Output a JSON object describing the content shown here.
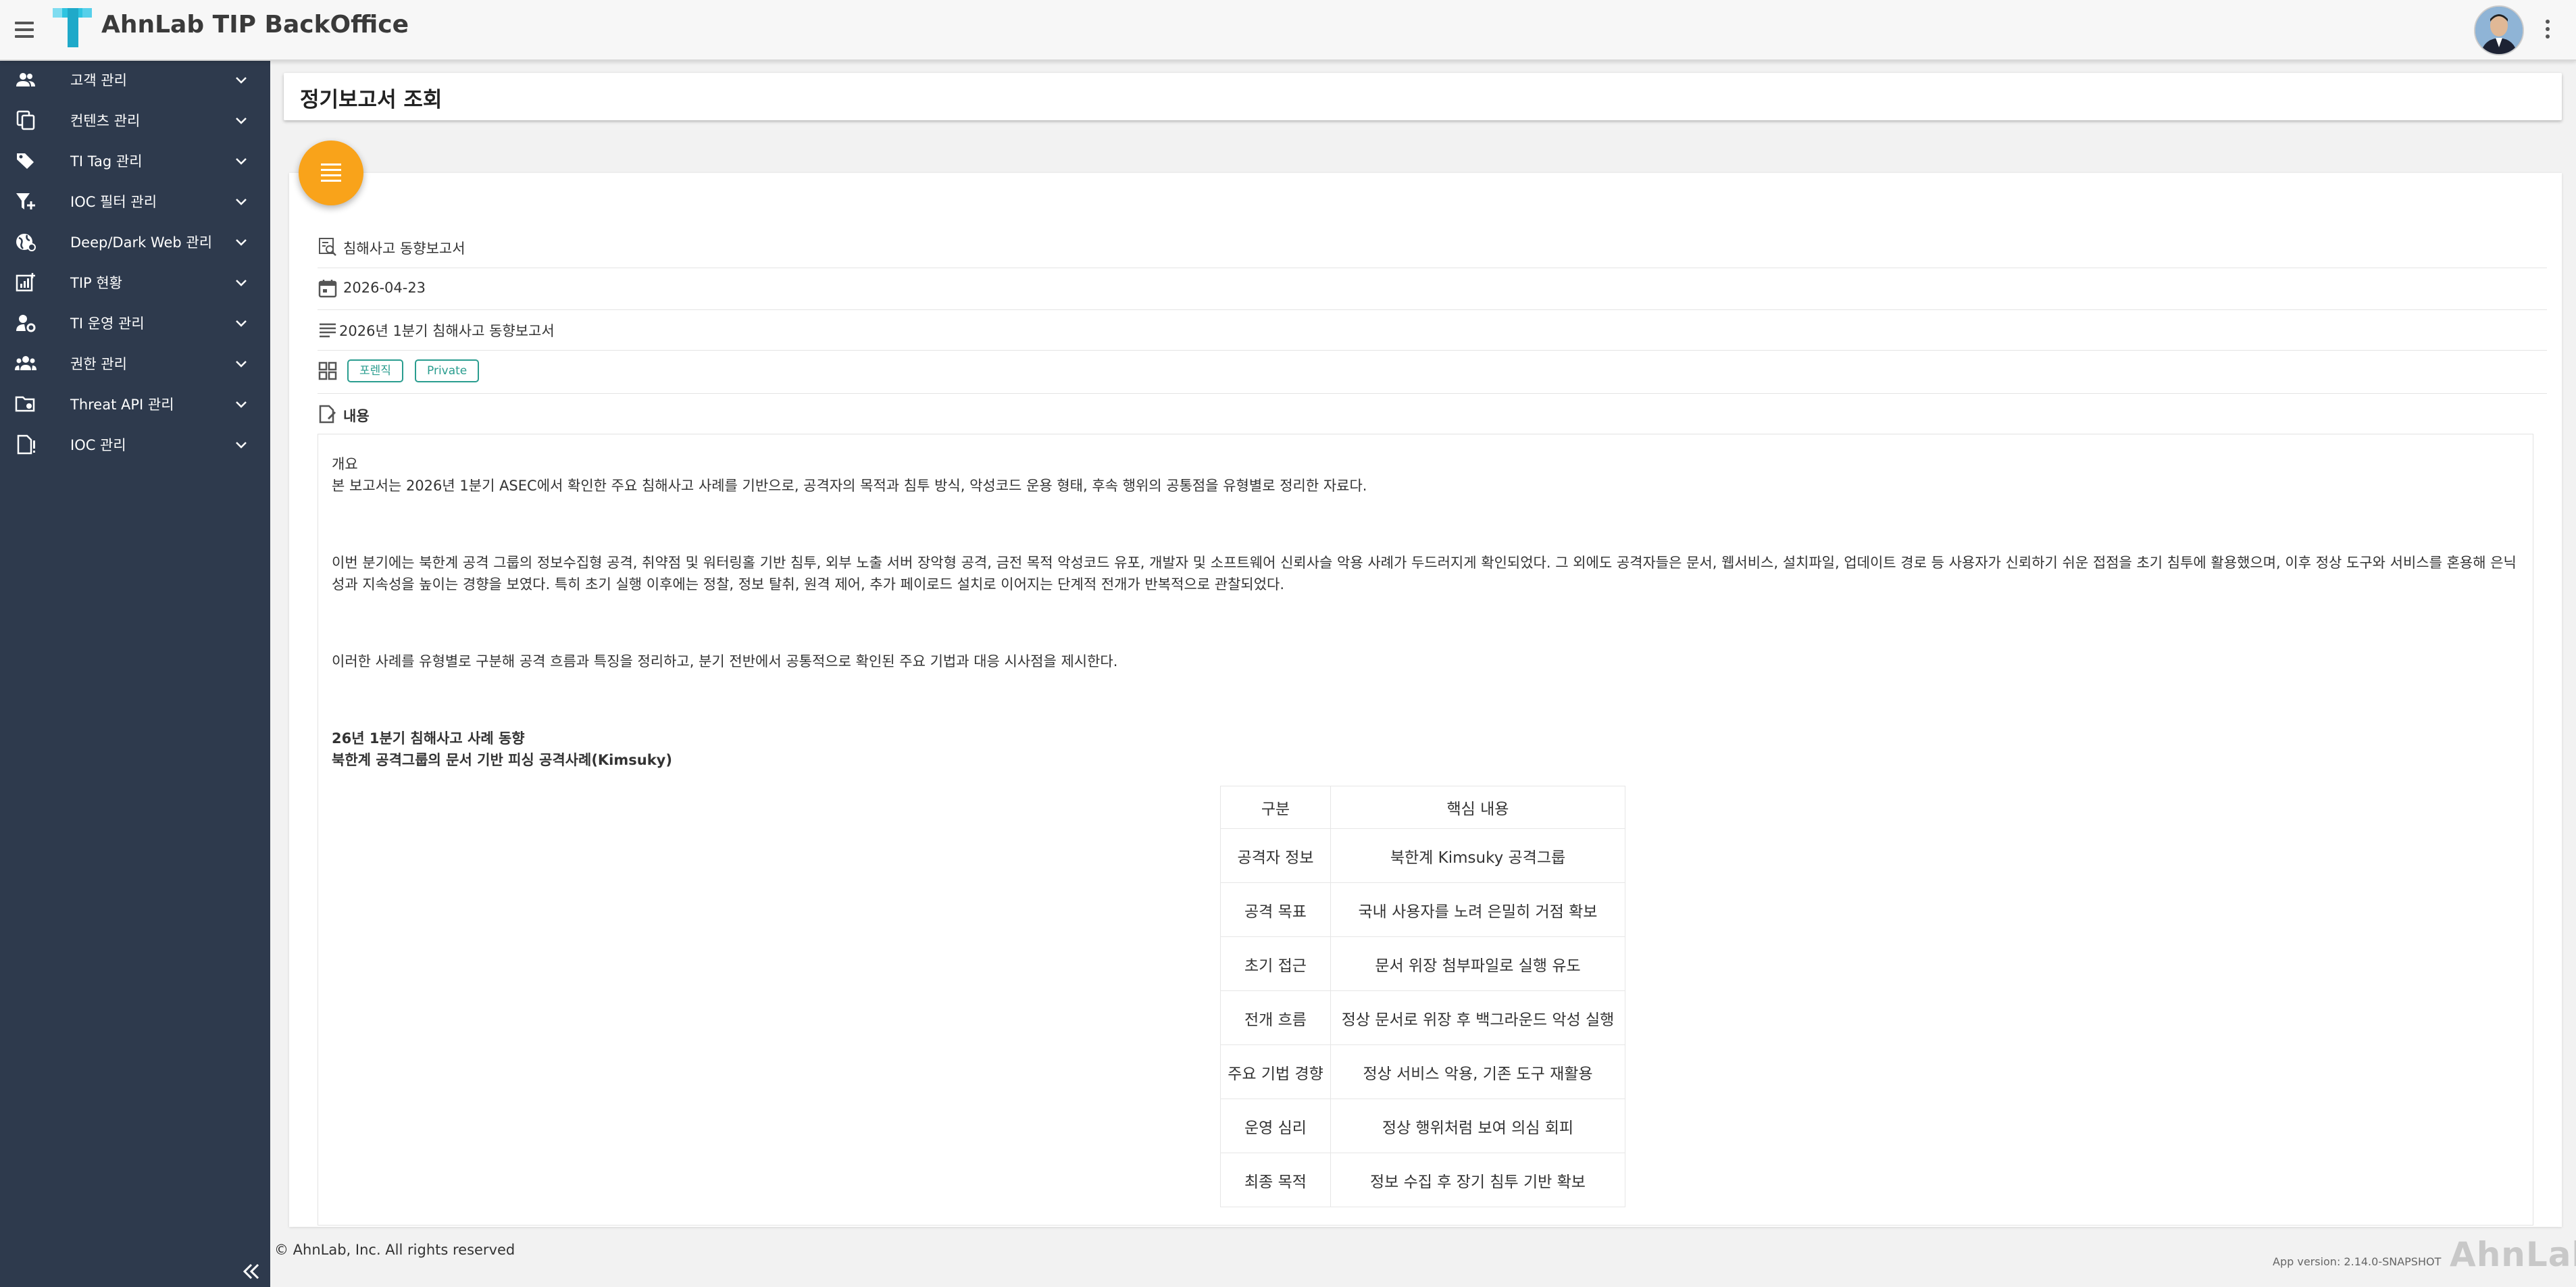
{
  "app": {
    "title": "AhnLab TIP BackOffice"
  },
  "sidebar": {
    "items": [
      {
        "label": "고객 관리",
        "icon": "users-icon"
      },
      {
        "label": "컨텐츠 관리",
        "icon": "copy-icon"
      },
      {
        "label": "TI Tag 관리",
        "icon": "tags-icon"
      },
      {
        "label": "IOC 필터 관리",
        "icon": "filter-add-icon"
      },
      {
        "label": "Deep/Dark Web 관리",
        "icon": "globe-icon"
      },
      {
        "label": "TIP 현황",
        "icon": "analytics-icon"
      },
      {
        "label": "TI 운영 관리",
        "icon": "user-gear-icon"
      },
      {
        "label": "권한 관리",
        "icon": "group-icon"
      },
      {
        "label": "Threat API 관리",
        "icon": "folder-gear-icon"
      },
      {
        "label": "IOC 관리",
        "icon": "document-info-icon"
      }
    ]
  },
  "page": {
    "title": "정기보고서 조회"
  },
  "report": {
    "type": "침해사고 동향보고서",
    "date": "2026-04-23",
    "name": "2026년 1분기 침해사고 동향보고서",
    "tags": [
      "포렌직",
      "Private"
    ],
    "content_label": "내용",
    "paragraphs": [
      "개요",
      "본 보고서는 2026년 1분기 ASEC에서 확인한 주요 침해사고 사례를 기반으로, 공격자의 목적과 침투 방식, 악성코드 운용 형태, 후속 행위의 공통점을 유형별로 정리한 자료다.",
      "이번 분기에는 북한계 공격 그룹의 정보수집형 공격, 취약점 및 워터링홀 기반 침투, 외부 노출 서버 장악형 공격, 금전 목적 악성코드 유포, 개발자 및 소프트웨어 신뢰사슬 악용 사례가 두드러지게 확인되었다. 그 외에도 공격자들은 문서, 웹서비스, 설치파일, 업데이트 경로 등 사용자가 신뢰하기 쉬운 접점을 초기 침투에 활용했으며, 이후 정상 도구와 서비스를 혼용해 은닉",
      "성과 지속성을 높이는 경향을 보였다. 특히 초기 실행 이후에는 정찰, 정보 탈취, 원격 제어, 추가 페이로드 설치로 이어지는 단계적 전개가 반복적으로 관찰되었다.",
      "이러한 사례를 유형별로 구분해 공격 흐름과 특징을 정리하고, 분기 전반에서 공통적으로 확인된 주요 기법과 대응 시사점을 제시한다.",
      "26년 1분기 침해사고 사례 동향",
      "북한계 공격그룹의 문서 기반 피싱 공격사례(Kimsuky)"
    ],
    "table": {
      "headers": [
        "구분",
        "핵심 내용"
      ],
      "rows": [
        [
          "공격자 정보",
          "북한계 Kimsuky 공격그룹"
        ],
        [
          "공격 목표",
          "국내 사용자를 노려 은밀히 거점 확보"
        ],
        [
          "초기 접근",
          "문서 위장 첨부파일로 실행 유도"
        ],
        [
          "전개 흐름",
          "정상 문서로 위장 후 백그라운드 악성 실행"
        ],
        [
          "주요 기법 경향",
          "정상 서비스 악용, 기존 도구 재활용"
        ],
        [
          "운영 심리",
          "정상 행위처럼 보여 의심 회피"
        ],
        [
          "최종 목적",
          "정보 수집 후 장기 침투 기반 확보"
        ]
      ]
    }
  },
  "footer": {
    "copyright": "© AhnLab, Inc. All rights reserved",
    "version": "App version: 2.14.0-SNAPSHOT",
    "brand": "AhnLab"
  },
  "colors": {
    "sidebar_bg": "#2e3a4d",
    "accent": "#f9a31a",
    "tag": "#2a9d8f"
  }
}
